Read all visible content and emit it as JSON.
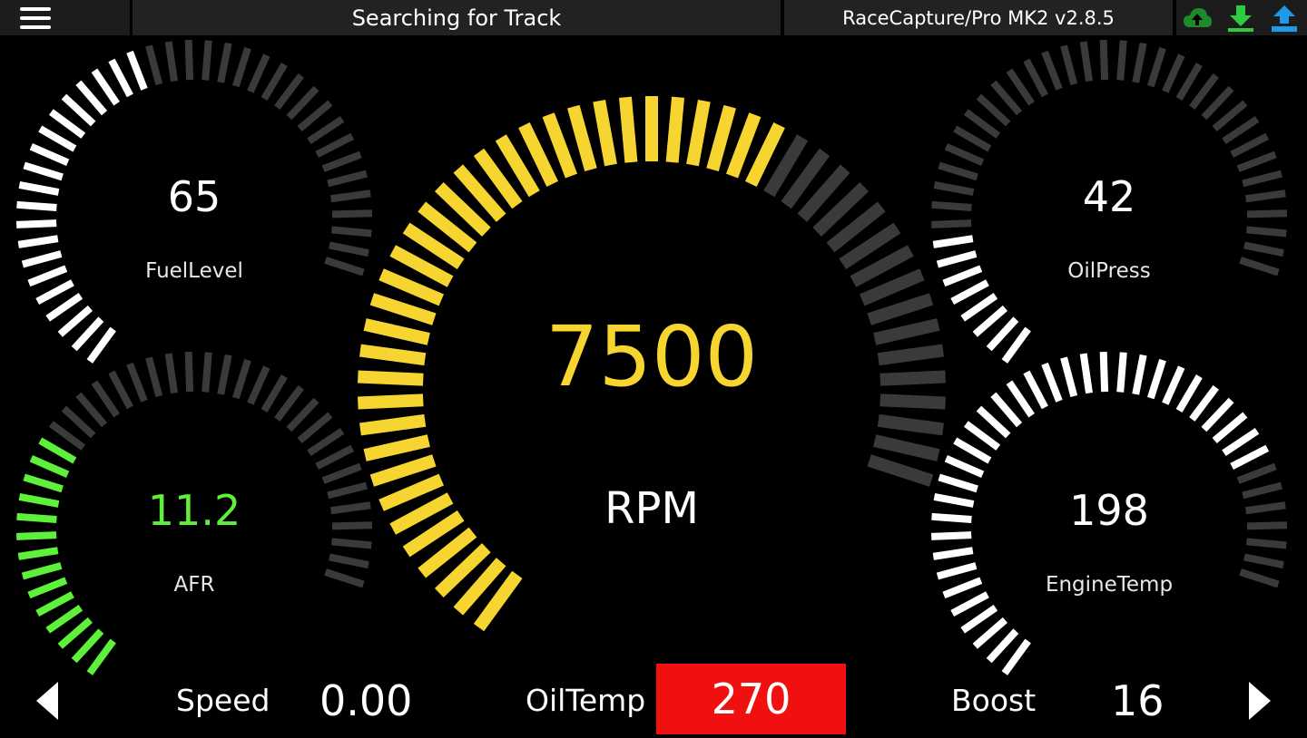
{
  "topbar": {
    "status": "Searching for Track",
    "device": "RaceCapture/Pro MK2 v2.8.5",
    "icons": [
      {
        "name": "cloud-upload-icon",
        "color": "#1f8a2a"
      },
      {
        "name": "download-icon",
        "color": "#2ecc40"
      },
      {
        "name": "upload-icon",
        "color": "#1e9be8"
      }
    ]
  },
  "gauges": {
    "fuel": {
      "label": "FuelLevel",
      "value": "65",
      "fraction": 0.5,
      "color": "#ffffff"
    },
    "afr": {
      "label": "AFR",
      "value": "11.2",
      "fraction": 0.35,
      "color": "#5ef03a"
    },
    "rpm": {
      "label": "RPM",
      "value": "7500",
      "fraction": 0.68,
      "color": "#f7d530"
    },
    "oil": {
      "label": "OilPress",
      "value": "42",
      "fraction": 0.2,
      "color": "#ffffff"
    },
    "engine": {
      "label": "EngineTemp",
      "value": "198",
      "fraction": 0.82,
      "color": "#ffffff"
    }
  },
  "bottom": {
    "speed_label": "Speed",
    "speed_value": "0.00",
    "oiltemp_label": "OilTemp",
    "oiltemp_value": "270",
    "oiltemp_alert_color": "#f01010",
    "boost_label": "Boost",
    "boost_value": "16"
  }
}
